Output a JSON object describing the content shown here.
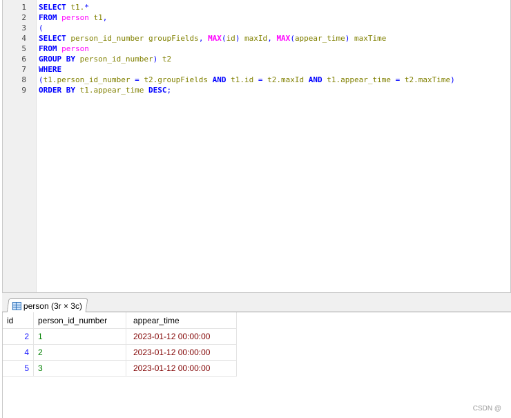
{
  "editor": {
    "line_numbers": [
      "1",
      "2",
      "3",
      "4",
      "5",
      "6",
      "7",
      "8",
      "9"
    ],
    "lines": [
      [
        {
          "t": "SELECT",
          "c": "kw"
        },
        {
          "t": " t1.",
          "c": "ident"
        },
        {
          "t": "*",
          "c": "op"
        }
      ],
      [
        {
          "t": "FROM",
          "c": "kw"
        },
        {
          "t": " ",
          "c": "ident"
        },
        {
          "t": "person",
          "c": "table"
        },
        {
          "t": " t1",
          "c": "ident"
        },
        {
          "t": ",",
          "c": "punct"
        }
      ],
      [
        {
          "t": "(",
          "c": "punct"
        }
      ],
      [
        {
          "t": "SELECT",
          "c": "kw"
        },
        {
          "t": " person_id_number groupFields",
          "c": "ident"
        },
        {
          "t": ", ",
          "c": "punct"
        },
        {
          "t": "MAX",
          "c": "func"
        },
        {
          "t": "(",
          "c": "punct"
        },
        {
          "t": "id",
          "c": "ident"
        },
        {
          "t": ")",
          "c": "punct"
        },
        {
          "t": " maxId",
          "c": "ident"
        },
        {
          "t": ", ",
          "c": "punct"
        },
        {
          "t": "MAX",
          "c": "func"
        },
        {
          "t": "(",
          "c": "punct"
        },
        {
          "t": "appear_time",
          "c": "ident"
        },
        {
          "t": ")",
          "c": "punct"
        },
        {
          "t": " maxTime",
          "c": "ident"
        }
      ],
      [
        {
          "t": "FROM",
          "c": "kw"
        },
        {
          "t": " ",
          "c": "ident"
        },
        {
          "t": "person",
          "c": "table"
        }
      ],
      [
        {
          "t": "GROUP BY",
          "c": "kw"
        },
        {
          "t": " person_id_number",
          "c": "ident"
        },
        {
          "t": ")",
          "c": "punct"
        },
        {
          "t": " t2",
          "c": "ident"
        }
      ],
      [
        {
          "t": "WHERE",
          "c": "kw"
        }
      ],
      [
        {
          "t": "(",
          "c": "punct"
        },
        {
          "t": "t1.person_id_number ",
          "c": "ident"
        },
        {
          "t": "=",
          "c": "op"
        },
        {
          "t": " t2.groupFields ",
          "c": "ident"
        },
        {
          "t": "AND",
          "c": "kw"
        },
        {
          "t": " t1.id ",
          "c": "ident"
        },
        {
          "t": "=",
          "c": "op"
        },
        {
          "t": " t2.maxId ",
          "c": "ident"
        },
        {
          "t": "AND",
          "c": "kw"
        },
        {
          "t": " t1.appear_time ",
          "c": "ident"
        },
        {
          "t": "=",
          "c": "op"
        },
        {
          "t": " t2.maxTime",
          "c": "ident"
        },
        {
          "t": ")",
          "c": "punct"
        }
      ],
      [
        {
          "t": "ORDER BY",
          "c": "kw"
        },
        {
          "t": " t1.appear_time ",
          "c": "ident"
        },
        {
          "t": "DESC",
          "c": "kw"
        },
        {
          "t": ";",
          "c": "punct"
        }
      ]
    ]
  },
  "result_tab": {
    "label": "person (3r × 3c)",
    "icon": "table-grid-icon"
  },
  "grid": {
    "columns": [
      "id",
      "person_id_number",
      "appear_time"
    ],
    "rows": [
      [
        "2",
        "1",
        "2023-01-12 00:00:00"
      ],
      [
        "4",
        "2",
        "2023-01-12 00:00:00"
      ],
      [
        "5",
        "3",
        "2023-01-12 00:00:00"
      ]
    ]
  },
  "watermark": "CSDN @",
  "colors": {
    "keyword": "#0000ff",
    "identifier": "#808000",
    "table_name": "#ff00ff",
    "id_value": "#1a1aff",
    "number_value": "#008000",
    "datetime_value": "#800000"
  }
}
